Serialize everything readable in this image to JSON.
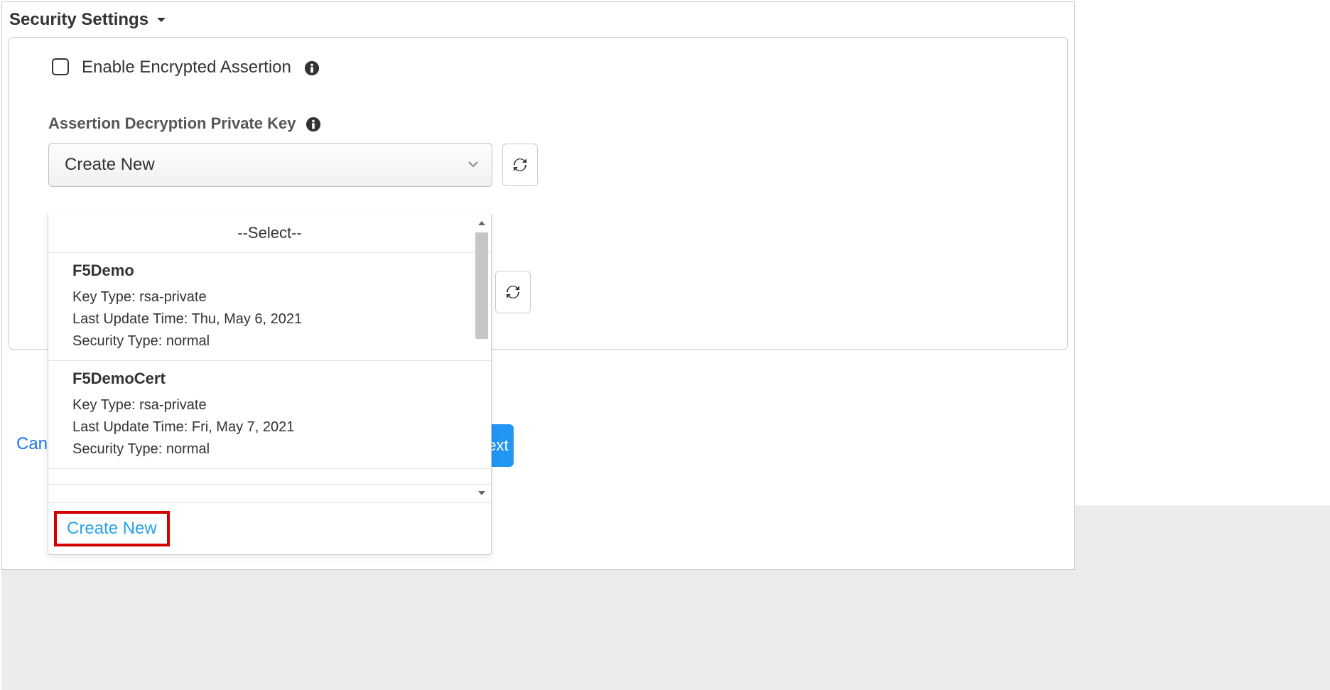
{
  "section": {
    "title": "Security Settings"
  },
  "checkbox": {
    "label": "Enable Encrypted Assertion"
  },
  "field": {
    "label": "Assertion Decryption Private Key",
    "selected": "Create New"
  },
  "dropdown": {
    "placeholder": "--Select--",
    "options": [
      {
        "name": "F5Demo",
        "key_type_label": "Key Type:",
        "key_type": "rsa-private",
        "last_update_label": "Last Update Time:",
        "last_update": "Thu, May 6, 2021",
        "security_type_label": "Security Type:",
        "security_type": "normal"
      },
      {
        "name": "F5DemoCert",
        "key_type_label": "Key Type:",
        "key_type": "rsa-private",
        "last_update_label": "Last Update Time:",
        "last_update": "Fri, May 7, 2021",
        "security_type_label": "Security Type:",
        "security_type": "normal"
      }
    ],
    "create_new": "Create New"
  },
  "footer": {
    "cancel": "Cancel",
    "save_next": "Save & Next"
  }
}
